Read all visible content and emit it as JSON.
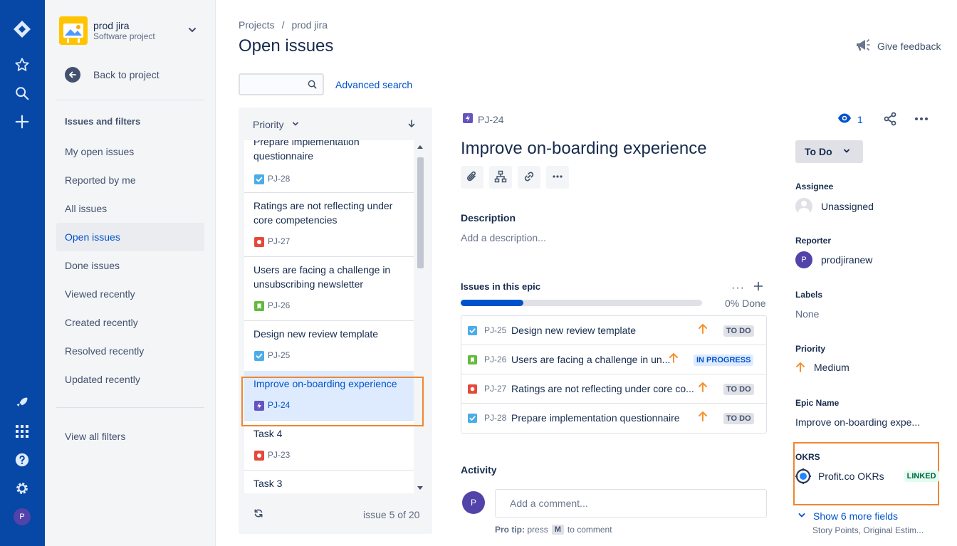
{
  "project": {
    "name": "prod jira",
    "type": "Software project"
  },
  "sidebar": {
    "back_label": "Back to project",
    "heading": "Issues and filters",
    "items": [
      {
        "label": "My open issues"
      },
      {
        "label": "Reported by me"
      },
      {
        "label": "All issues"
      },
      {
        "label": "Open issues",
        "active": true
      },
      {
        "label": "Done issues"
      },
      {
        "label": "Viewed recently"
      },
      {
        "label": "Created recently"
      },
      {
        "label": "Resolved recently"
      },
      {
        "label": "Updated recently"
      }
    ],
    "view_all_filters": "View all filters"
  },
  "breadcrumb": {
    "root": "Projects",
    "separator": "/",
    "current": "prod jira"
  },
  "page_title": "Open issues",
  "feedback_label": "Give feedback",
  "search": {
    "value": "",
    "placeholder": ""
  },
  "advanced_search": "Advanced search",
  "list": {
    "sort_label": "Priority",
    "issues": [
      {
        "summary": "Prepare implementation questionnaire",
        "key": "PJ-28",
        "type": "task"
      },
      {
        "summary": "Ratings are not reflecting under core competencies",
        "key": "PJ-27",
        "type": "bug"
      },
      {
        "summary": "Users are facing a challenge in unsubscribing newsletter",
        "key": "PJ-26",
        "type": "story"
      },
      {
        "summary": "Design new review template",
        "key": "PJ-25",
        "type": "task"
      },
      {
        "summary": "Improve on-boarding experience",
        "key": "PJ-24",
        "type": "epic"
      },
      {
        "summary": "Task 4",
        "key": "PJ-23",
        "type": "bug"
      },
      {
        "summary": "Task 3",
        "key": "",
        "type": "bug"
      }
    ],
    "footer": "issue 5 of 20"
  },
  "issue": {
    "key": "PJ-24",
    "title": "Improve on-boarding experience",
    "description_label": "Description",
    "description_placeholder": "Add a description...",
    "epic_section_label": "Issues in this epic",
    "epic_progress": 0.26,
    "epic_done": "0% Done",
    "epic_issues": [
      {
        "key": "PJ-25",
        "summary": "Design new review template",
        "status": "TO DO",
        "type": "task"
      },
      {
        "key": "PJ-26",
        "summary": "Users are facing a challenge in un...",
        "status": "IN PROGRESS",
        "type": "story"
      },
      {
        "key": "PJ-27",
        "summary": "Ratings are not reflecting under core co...",
        "status": "TO DO",
        "type": "bug"
      },
      {
        "key": "PJ-28",
        "summary": "Prepare implementation questionnaire",
        "status": "TO DO",
        "type": "task"
      }
    ],
    "activity_label": "Activity",
    "comment_placeholder": "Add a comment...",
    "pro_tip_prefix": "Pro tip:",
    "pro_tip_press": "press",
    "pro_tip_key": "M",
    "pro_tip_suffix": "to comment",
    "avatar_initial": "P"
  },
  "details": {
    "watchers": "1",
    "status": "To Do",
    "assignee_label": "Assignee",
    "assignee": "Unassigned",
    "reporter_label": "Reporter",
    "reporter": "prodjiranew",
    "reporter_initial": "P",
    "labels_label": "Labels",
    "labels": "None",
    "priority_label": "Priority",
    "priority": "Medium",
    "epic_name_label": "Epic Name",
    "epic_name": "Improve on-boarding expe...",
    "okrs_label": "OKRS",
    "okrs_value": "Profit.co OKRs",
    "okrs_badge": "LINKED",
    "show_more": "Show 6 more fields",
    "show_more_sub": "Story Points, Original Estim..."
  },
  "user_initial": "P",
  "colors": {
    "nav": "#0747A6",
    "accent": "#0052CC",
    "highlight": "#F08632",
    "epic": "#6554C0",
    "task": "#4BADE8",
    "bug": "#E5493A",
    "story": "#63BA3C",
    "priority_medium": "#F79232"
  }
}
